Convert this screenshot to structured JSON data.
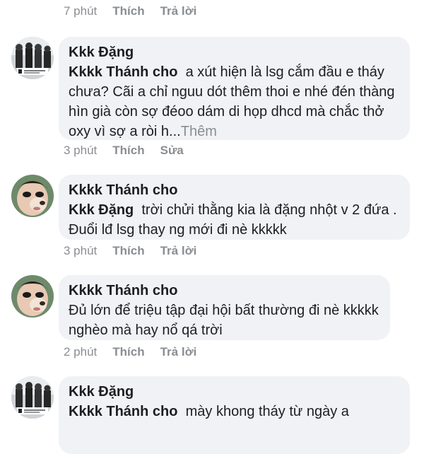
{
  "top": {
    "time": "7 phút",
    "like": "Thích",
    "reply": "Trả lời"
  },
  "comments": [
    {
      "author": "Kkk Đặng",
      "mention": "Kkkk Thánh cho",
      "text": "a xút hiện là lsg cắm đầu e tháy chưa? Cãi a chỉ nguu dót thêm thoi e nhé đén thàng hìn già còn sợ đéoo dám di họp dhcd mà chắc thở oxy vì sợ a ròi h...",
      "more": "Thêm",
      "time": "3 phút",
      "like": "Thích",
      "reply": "Sửa"
    },
    {
      "author": "Kkkk Thánh cho",
      "mention": "Kkk Đặng",
      "text": "trời chửi thằng kia là đặng nhột v 2 đứa . Đuổi lđ lsg thay ng mới đi nè kkkkk",
      "time": "3 phút",
      "like": "Thích",
      "reply": "Trả lời"
    },
    {
      "author": "Kkkk Thánh cho",
      "text": "Đủ lớn để triệu tập đại hội bất thường đi nè kkkkk nghèo mà hay nổ qá trời",
      "time": "2 phút",
      "like": "Thích",
      "reply": "Trả lời"
    },
    {
      "author": "Kkk Đặng",
      "mention": "Kkkk Thánh cho",
      "text": "mày khong tháy từ ngày a"
    }
  ]
}
